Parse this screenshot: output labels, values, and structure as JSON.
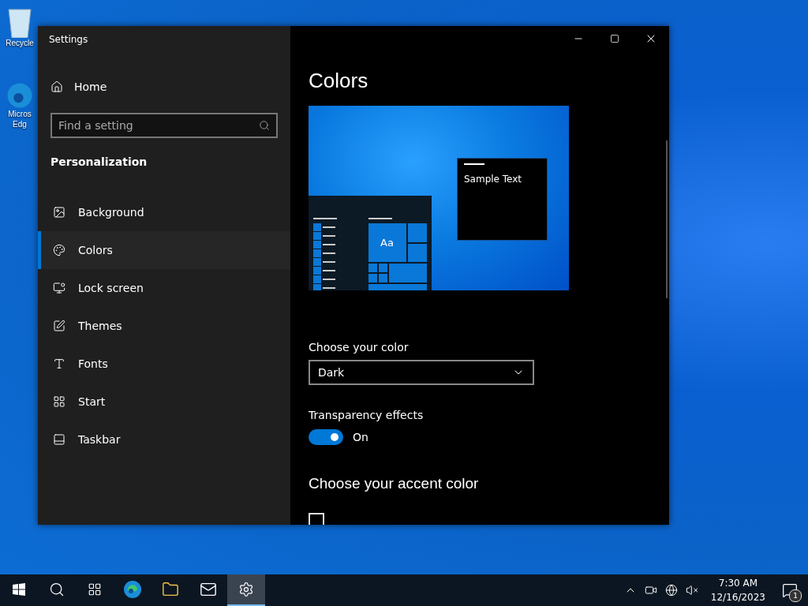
{
  "desktop_icons": [
    {
      "lines": [
        "Recycle"
      ]
    },
    {
      "lines": [
        "Micros",
        "Edg"
      ]
    }
  ],
  "window": {
    "title": "Settings"
  },
  "sidebar": {
    "home": "Home",
    "search": {
      "placeholder": "Find a setting"
    },
    "section": "Personalization",
    "items": [
      {
        "label": "Background",
        "selected": false
      },
      {
        "label": "Colors",
        "selected": true
      },
      {
        "label": "Lock screen",
        "selected": false
      },
      {
        "label": "Themes",
        "selected": false
      },
      {
        "label": "Fonts",
        "selected": false
      },
      {
        "label": "Start",
        "selected": false
      },
      {
        "label": "Taskbar",
        "selected": false
      }
    ]
  },
  "content": {
    "title": "Colors",
    "preview": {
      "sample_text": "Sample Text",
      "tile_text": "Aa"
    },
    "color_mode": {
      "label": "Choose your color",
      "value": "Dark"
    },
    "transparency": {
      "label": "Transparency effects",
      "on": true,
      "state_text": "On"
    },
    "accent_heading": "Choose your accent color",
    "auto_accent": {
      "checked": false
    }
  },
  "taskbar": {
    "buttons": [
      {
        "kind": "start",
        "selected": false
      },
      {
        "kind": "search",
        "selected": false
      },
      {
        "kind": "taskview",
        "selected": false
      },
      {
        "kind": "edge",
        "selected": false
      },
      {
        "kind": "explorer",
        "selected": false
      },
      {
        "kind": "mail",
        "selected": false
      },
      {
        "kind": "settings",
        "selected": true
      }
    ],
    "time": "7:30 AM",
    "date": "12/16/2023",
    "notification_count": "1"
  }
}
